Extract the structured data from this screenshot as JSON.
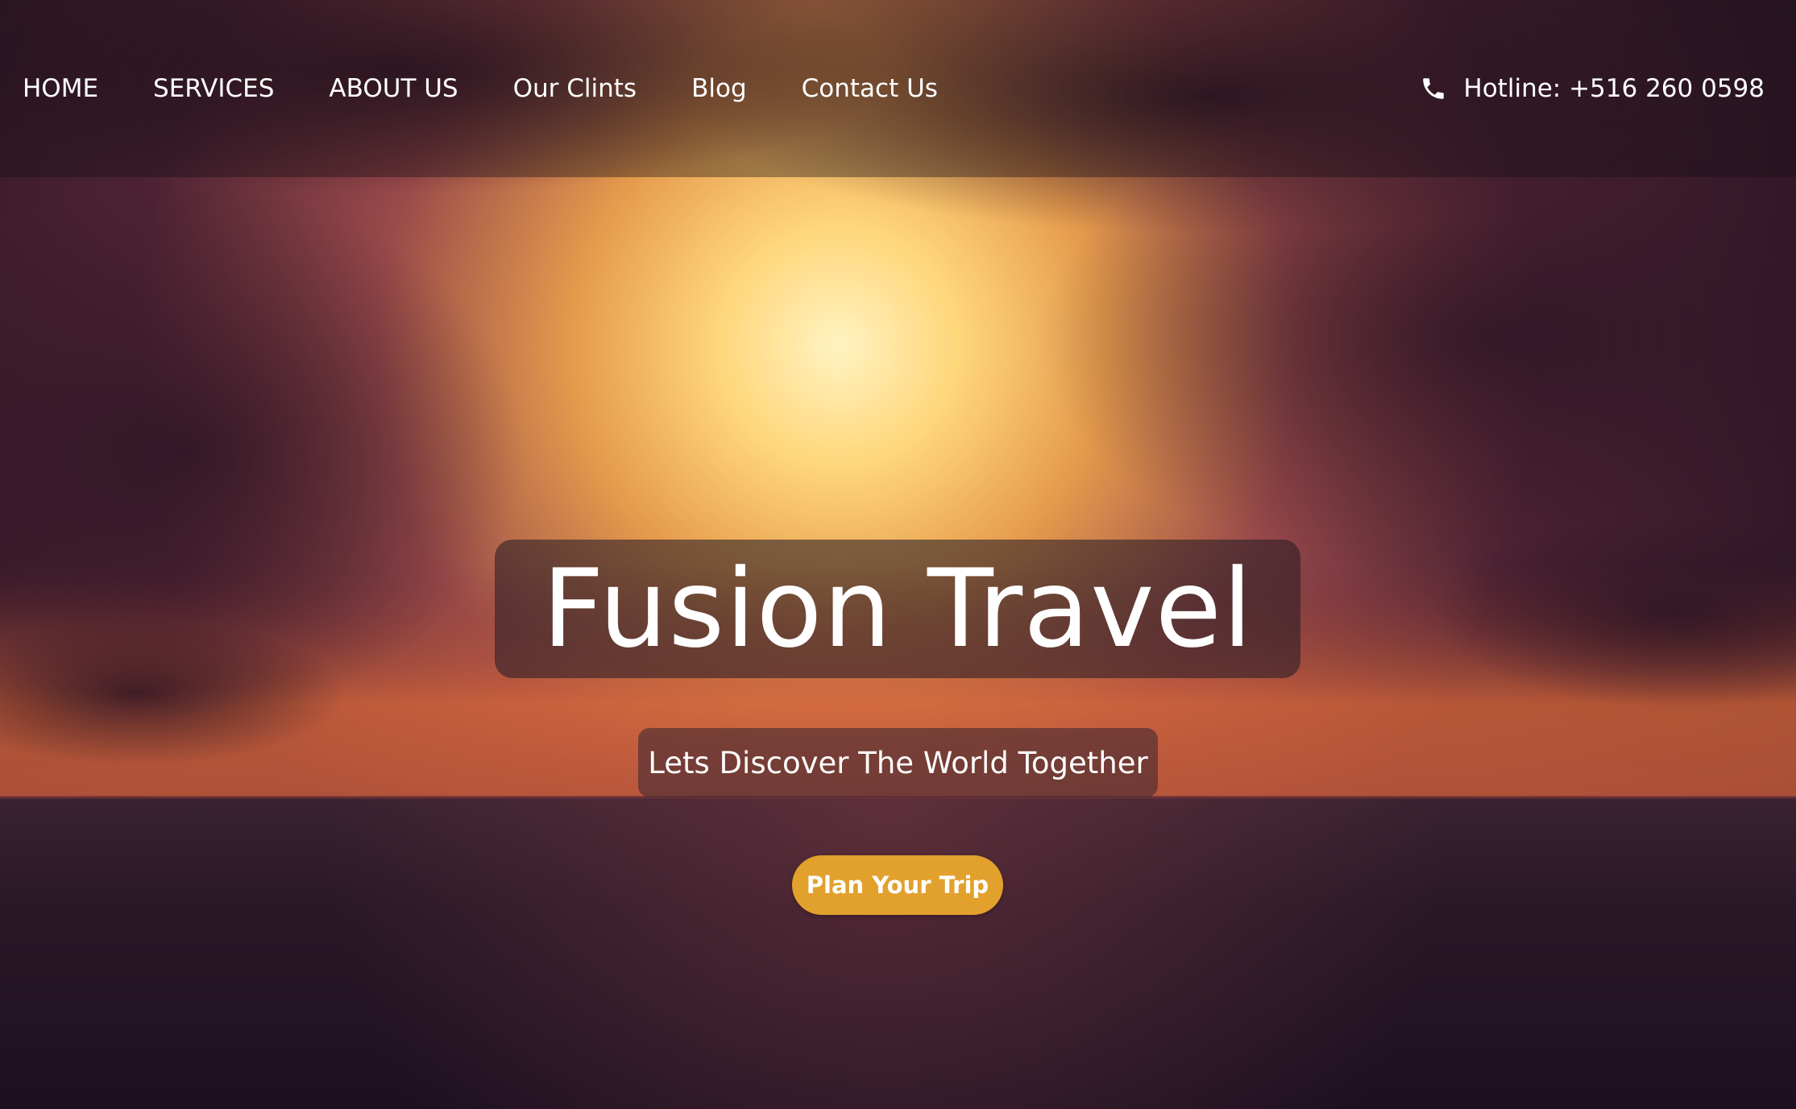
{
  "nav": {
    "items": [
      {
        "label": "HOME"
      },
      {
        "label": "SERVICES"
      },
      {
        "label": "ABOUT US"
      },
      {
        "label": "Our Clints"
      },
      {
        "label": "Blog"
      },
      {
        "label": "Contact Us"
      }
    ]
  },
  "hotline": {
    "icon": "phone-icon",
    "label": "Hotline: +516 260 0598"
  },
  "hero": {
    "title": "Fusion Travel",
    "tagline": "Lets Discover The World Together",
    "cta_label": "Plan Your Trip"
  },
  "colors": {
    "accent": "#e2a02c",
    "text": "#ffffff"
  }
}
